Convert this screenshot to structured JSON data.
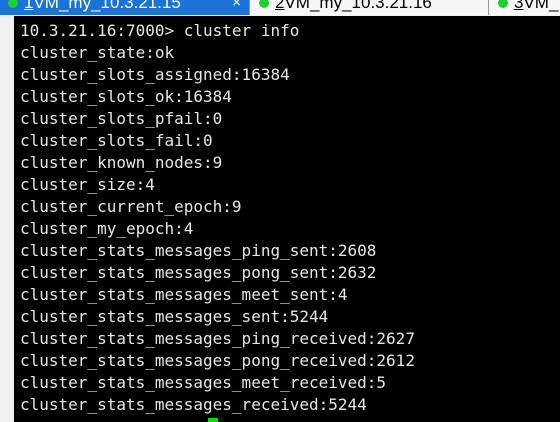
{
  "tabs": [
    {
      "number": "1",
      "title": " VM_my_10.3.21.15",
      "active": true,
      "close": "×"
    },
    {
      "number": "2",
      "title": " VM_my_10.3.21.16",
      "active": false
    },
    {
      "number": "3",
      "title": " VM_",
      "active": false
    }
  ],
  "colors": {
    "tab_active": "#1a73d9",
    "status_connected": "#1fd12f",
    "terminal_bg": "#000000",
    "terminal_fg": "#e6e6e6",
    "cursor": "#00e000"
  },
  "terminal": {
    "lines": [
      "10.3.21.16:7000> cluster info",
      "cluster_state:ok",
      "cluster_slots_assigned:16384",
      "cluster_slots_ok:16384",
      "cluster_slots_pfail:0",
      "cluster_slots_fail:0",
      "cluster_known_nodes:9",
      "cluster_size:4",
      "cluster_current_epoch:9",
      "cluster_my_epoch:4",
      "cluster_stats_messages_ping_sent:2608",
      "cluster_stats_messages_pong_sent:2632",
      "cluster_stats_messages_meet_sent:4",
      "cluster_stats_messages_sent:5244",
      "cluster_stats_messages_ping_received:2627",
      "cluster_stats_messages_pong_received:2612",
      "cluster_stats_messages_meet_received:5",
      "cluster_stats_messages_received:5244"
    ]
  }
}
